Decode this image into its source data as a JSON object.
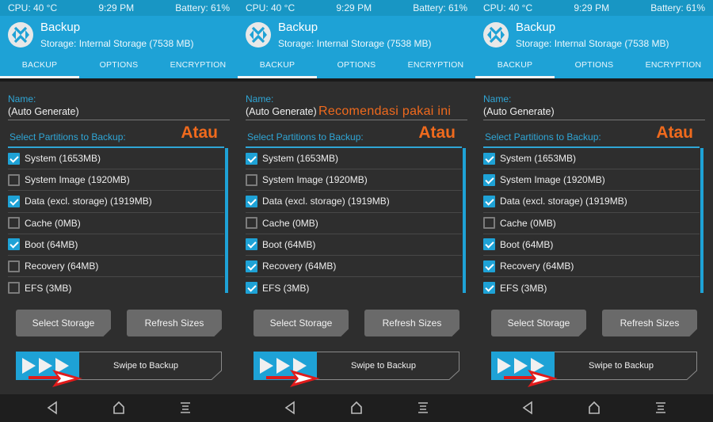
{
  "colors": {
    "accent": "#1ea2d6",
    "status_bar": "#1896c4",
    "background": "#2e2e2e",
    "annotation": "#f06a1d",
    "nav_bar": "#1e1e1e"
  },
  "panels": [
    {
      "status": {
        "cpu": "CPU: 40 °C",
        "time": "9:29 PM",
        "battery": "Battery: 61%"
      },
      "header": {
        "title": "Backup",
        "subtitle": "Storage: Internal Storage (7538 MB)",
        "logo_icon": "twrp-logo-icon"
      },
      "tabs": [
        {
          "label": "BACKUP",
          "active": true
        },
        {
          "label": "OPTIONS",
          "active": false
        },
        {
          "label": "ENCRYPTION",
          "active": false
        }
      ],
      "name": {
        "label": "Name:",
        "value": "(Auto Generate)"
      },
      "annotation_top": "",
      "annotation_atau": "Atau",
      "partitions_label": "Select Partitions to Backup:",
      "partitions": [
        {
          "label": "System (1653MB)",
          "checked": true
        },
        {
          "label": "System Image (1920MB)",
          "checked": false
        },
        {
          "label": "Data (excl. storage) (1919MB)",
          "checked": true
        },
        {
          "label": "Cache (0MB)",
          "checked": false
        },
        {
          "label": "Boot (64MB)",
          "checked": true
        },
        {
          "label": "Recovery (64MB)",
          "checked": false
        },
        {
          "label": "EFS (3MB)",
          "checked": false
        }
      ],
      "buttons": {
        "select_storage": "Select Storage",
        "refresh_sizes": "Refresh Sizes"
      },
      "swipe": {
        "label": "Swipe to Backup"
      },
      "nav": {
        "back_icon": "back-triangle-icon",
        "home_icon": "home-icon",
        "menu_icon": "menu-lines-icon"
      }
    },
    {
      "status": {
        "cpu": "CPU: 40 °C",
        "time": "9:29 PM",
        "battery": "Battery: 61%"
      },
      "header": {
        "title": "Backup",
        "subtitle": "Storage: Internal Storage (7538 MB)",
        "logo_icon": "twrp-logo-icon"
      },
      "tabs": [
        {
          "label": "BACKUP",
          "active": true
        },
        {
          "label": "OPTIONS",
          "active": false
        },
        {
          "label": "ENCRYPTION",
          "active": false
        }
      ],
      "name": {
        "label": "Name:",
        "value": "(Auto Generate)"
      },
      "annotation_top": "Recomendasi pakai ini",
      "annotation_atau": "Atau",
      "partitions_label": "Select Partitions to Backup:",
      "partitions": [
        {
          "label": "System (1653MB)",
          "checked": true
        },
        {
          "label": "System Image (1920MB)",
          "checked": false
        },
        {
          "label": "Data (excl. storage) (1919MB)",
          "checked": true
        },
        {
          "label": "Cache (0MB)",
          "checked": false
        },
        {
          "label": "Boot (64MB)",
          "checked": true
        },
        {
          "label": "Recovery (64MB)",
          "checked": true
        },
        {
          "label": "EFS (3MB)",
          "checked": true
        }
      ],
      "buttons": {
        "select_storage": "Select Storage",
        "refresh_sizes": "Refresh Sizes"
      },
      "swipe": {
        "label": "Swipe to Backup"
      },
      "nav": {
        "back_icon": "back-triangle-icon",
        "home_icon": "home-icon",
        "menu_icon": "menu-lines-icon"
      }
    },
    {
      "status": {
        "cpu": "CPU: 40 °C",
        "time": "9:29 PM",
        "battery": "Battery: 61%"
      },
      "header": {
        "title": "Backup",
        "subtitle": "Storage: Internal Storage (7538 MB)",
        "logo_icon": "twrp-logo-icon"
      },
      "tabs": [
        {
          "label": "BACKUP",
          "active": true
        },
        {
          "label": "OPTIONS",
          "active": false
        },
        {
          "label": "ENCRYPTION",
          "active": false
        }
      ],
      "name": {
        "label": "Name:",
        "value": "(Auto Generate)"
      },
      "annotation_top": "",
      "annotation_atau": "Atau",
      "partitions_label": "Select Partitions to Backup:",
      "partitions": [
        {
          "label": "System (1653MB)",
          "checked": true
        },
        {
          "label": "System Image (1920MB)",
          "checked": true
        },
        {
          "label": "Data (excl. storage) (1919MB)",
          "checked": true
        },
        {
          "label": "Cache (0MB)",
          "checked": false
        },
        {
          "label": "Boot (64MB)",
          "checked": true
        },
        {
          "label": "Recovery (64MB)",
          "checked": true
        },
        {
          "label": "EFS (3MB)",
          "checked": true
        }
      ],
      "buttons": {
        "select_storage": "Select Storage",
        "refresh_sizes": "Refresh Sizes"
      },
      "swipe": {
        "label": "Swipe to Backup"
      },
      "nav": {
        "back_icon": "back-triangle-icon",
        "home_icon": "home-icon",
        "menu_icon": "menu-lines-icon"
      }
    }
  ]
}
